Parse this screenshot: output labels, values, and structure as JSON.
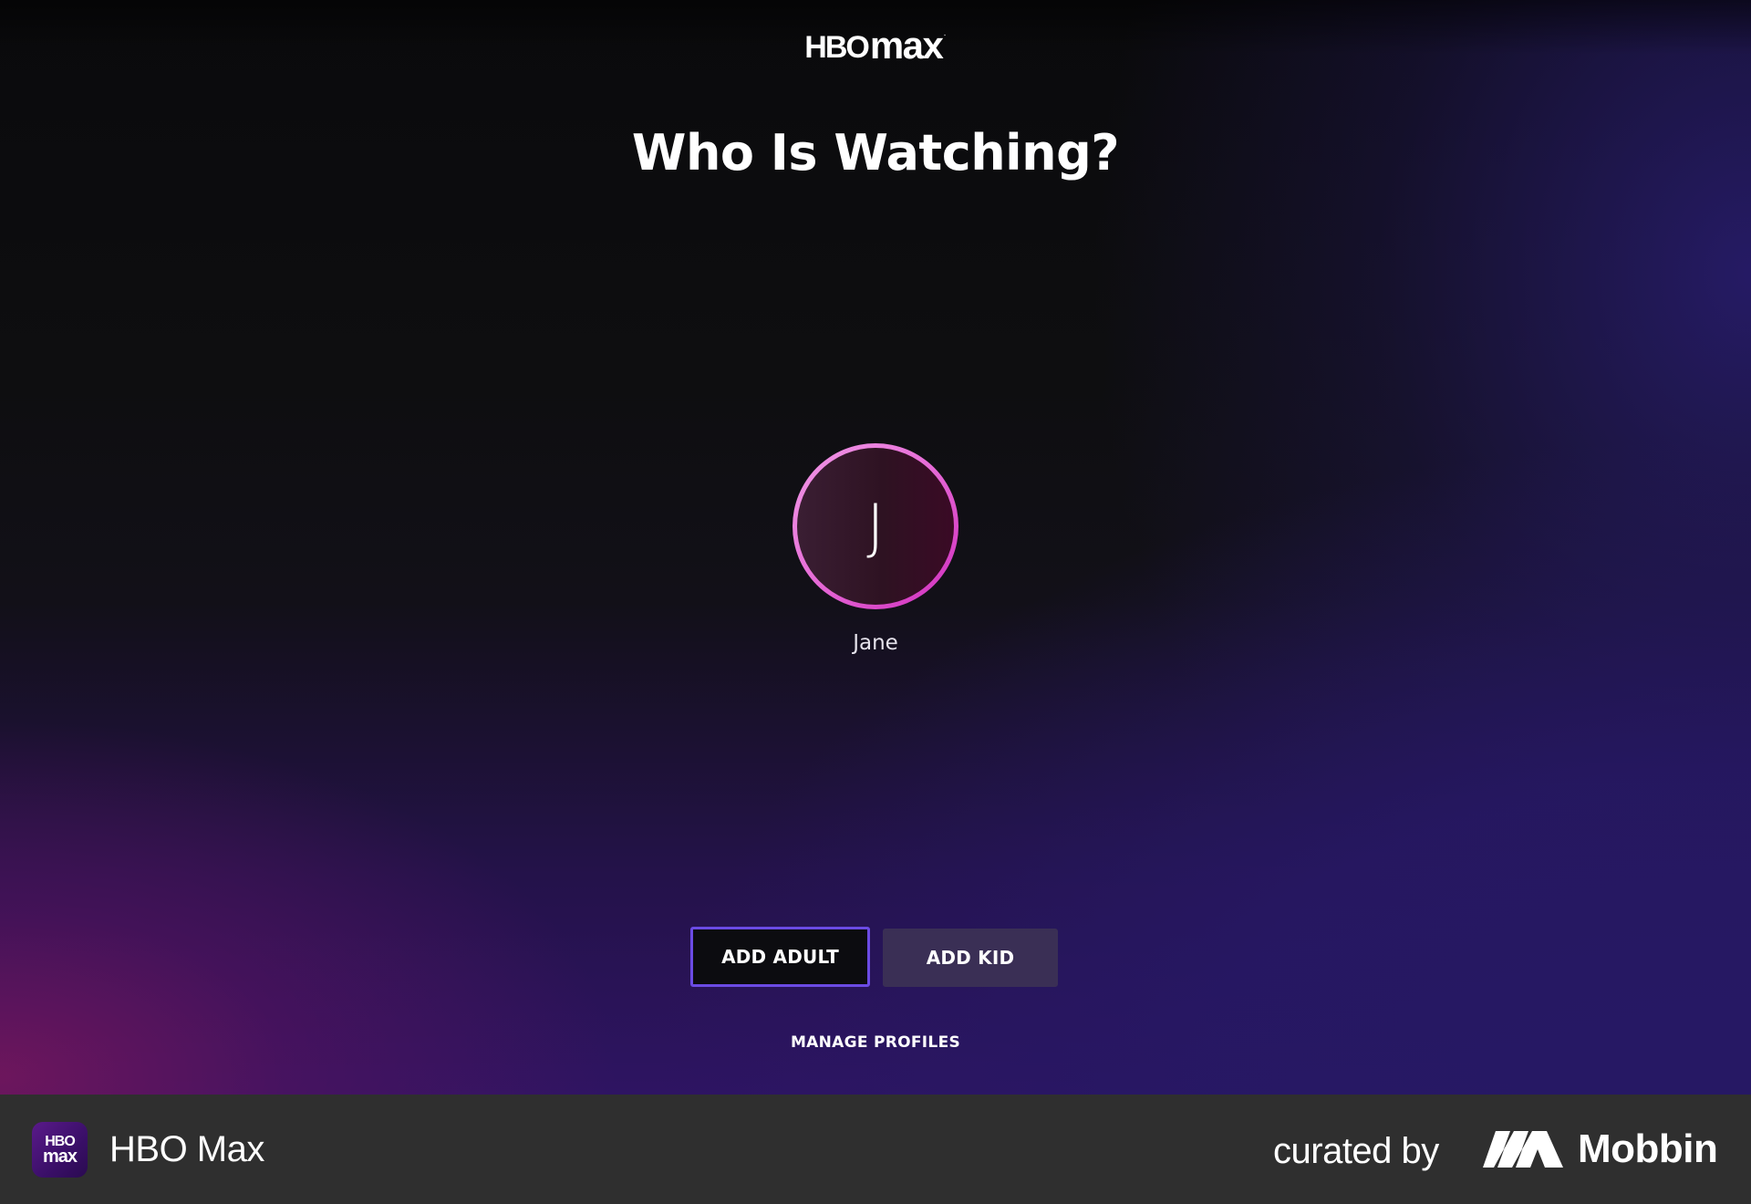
{
  "brand": {
    "logo_part1": "HBO",
    "logo_part2": "max",
    "logo_mark": "·"
  },
  "heading": "Who Is Watching?",
  "profiles": [
    {
      "initial": "J",
      "name": "Jane",
      "ring_colors": [
        "#f09ae6",
        "#d02cbd"
      ]
    }
  ],
  "actions": {
    "add_adult": "ADD ADULT",
    "add_kid": "ADD KID",
    "manage_profiles": "MANAGE PROFILES"
  },
  "colors": {
    "accent_border": "#6b4be4",
    "secondary_button": "#3a2f55",
    "footer_bg": "#2f2f2f"
  },
  "footer": {
    "app_icon_line1": "HBO",
    "app_icon_line2": "max",
    "app_name": "HBO Max",
    "curated_by": "curated by",
    "brand": "Mobbin",
    "brand_icon": "mobbin-logo-icon"
  }
}
